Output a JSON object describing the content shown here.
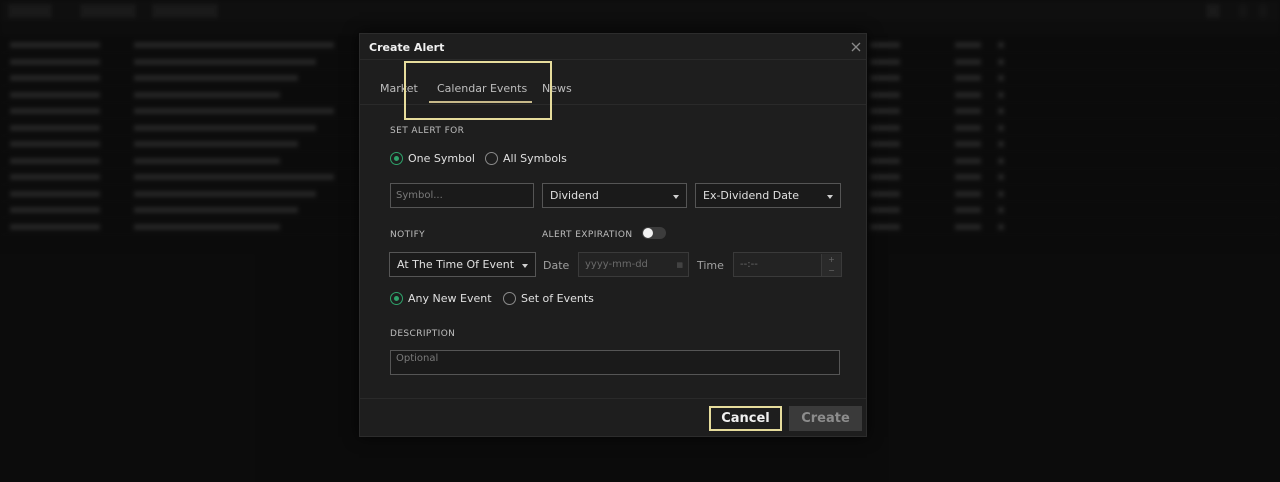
{
  "modal": {
    "title": "Create Alert",
    "tabs": [
      {
        "label": "Market"
      },
      {
        "label": "Calendar Events",
        "active": true
      },
      {
        "label": "News"
      }
    ],
    "set_alert_for": {
      "label": "SET ALERT FOR",
      "options": [
        {
          "label": "One Symbol",
          "checked": true
        },
        {
          "label": "All Symbols",
          "checked": false
        }
      ]
    },
    "symbol_input": {
      "placeholder": "Symbol..."
    },
    "event_type_select": {
      "value": "Dividend"
    },
    "event_date_select": {
      "value": "Ex-Dividend Date"
    },
    "notify": {
      "label": "NOTIFY",
      "select_value": "At The Time Of Event"
    },
    "alert_expiration": {
      "label": "ALERT EXPIRATION",
      "enabled": false,
      "date_label": "Date",
      "date_placeholder": "yyyy-mm-dd",
      "time_label": "Time",
      "time_placeholder": "--:--"
    },
    "event_scope": {
      "options": [
        {
          "label": "Any New Event",
          "checked": true
        },
        {
          "label": "Set of Events",
          "checked": false
        }
      ]
    },
    "description": {
      "label": "DESCRIPTION",
      "placeholder": "Optional"
    },
    "buttons": {
      "cancel": "Cancel",
      "create": "Create"
    }
  },
  "colors": {
    "accent_green": "#2ea36b",
    "highlight": "#e6dc9c",
    "tab_underline": "#c7b98a",
    "modal_bg": "#1e1e1e"
  },
  "icons": {
    "close": "close-icon",
    "dropdown": "chevron-down-icon",
    "calendar": "calendar-icon"
  }
}
